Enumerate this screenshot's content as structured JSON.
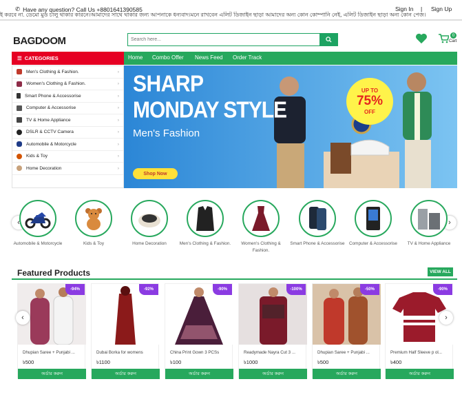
{
  "topbar": {
    "phone": "Have any question? Call Us +8801641390585",
    "sign_in": "Sign In",
    "separator": "|",
    "sign_up": "Sign Up"
  },
  "marquee": "ই করবে না. ডেমো মুড চালু থাকার কারনে।আমাদের সাথে থাকার জন্য আপনাকে ধন্যবাদ।মনে রাখবেন এলিট ডিজাইন ছাড়া আমাদের অন্য কোন কোম্পানি নেই, এলিট ডিজাইন ছাড়া অন্য কোন পেজ।",
  "logo": "BAGDOOM",
  "search": {
    "placeholder": "Search here..."
  },
  "cart": {
    "count": "0",
    "label": "Cart"
  },
  "categories_title": "CATEGORIES",
  "nav": [
    "Home",
    "Combo Offer",
    "News Feed",
    "Order Track"
  ],
  "categories": [
    "Men's Clothing & Fashion.",
    "Women's Clothing & Fashion.",
    "Smart Phone & Accessorise",
    "Computer & Accessorise",
    "TV & Home Appliance",
    "DSLR & CCTV Camera",
    "Automobile & Motorcycle",
    "Kids & Toy",
    "Home Decoration"
  ],
  "banner": {
    "line1": "SHARP",
    "line2": "MONDAY STYLE",
    "line3": "Men's Fashion",
    "button": "Shop Now",
    "offer_top": "UP TO",
    "offer_pct": "75%",
    "offer_bottom": "OFF"
  },
  "circle_categories": [
    {
      "label": "Automobile & Motorcycle"
    },
    {
      "label": "Kids & Toy"
    },
    {
      "label": "Home Decoration"
    },
    {
      "label": "Men's Clothing & Fashion."
    },
    {
      "label": "Women's Clothing & Fashion."
    },
    {
      "label": "Smart Phone & Accessorise"
    },
    {
      "label": "Computer & Accessorise"
    },
    {
      "label": "TV & Home Appliance"
    }
  ],
  "featured": {
    "title": "Featured Products",
    "view_all": "VIEW ALL",
    "products": [
      {
        "name": "Dhupian Saree + Punjabi ...",
        "price": "৳500",
        "badge": "-94%",
        "buy": "অর্ডার করুন"
      },
      {
        "name": "Dubai Borka for womens",
        "price": "৳1100",
        "badge": "-92%",
        "buy": "অর্ডার করুন"
      },
      {
        "name": "China Print Gown 3 PCSs",
        "price": "৳100",
        "badge": "-90%",
        "buy": "অর্ডার করুন"
      },
      {
        "name": "Readymade Nayra Cut 3 ...",
        "price": "৳1000",
        "badge": "-100%",
        "buy": "অর্ডার করুন"
      },
      {
        "name": "Dhupian Saree + Punjabi ...",
        "price": "৳500",
        "badge": "-50%",
        "buy": "অর্ডার করুন"
      },
      {
        "name": "Premium Half Sleeve p ol...",
        "price": "৳400",
        "badge": "-90%",
        "buy": "অর্ডার করুন"
      }
    ]
  },
  "colors": {
    "accent": "#27a85d",
    "category_header": "#e60023",
    "badge": "#8b3be2",
    "banner": "#3a95df"
  }
}
